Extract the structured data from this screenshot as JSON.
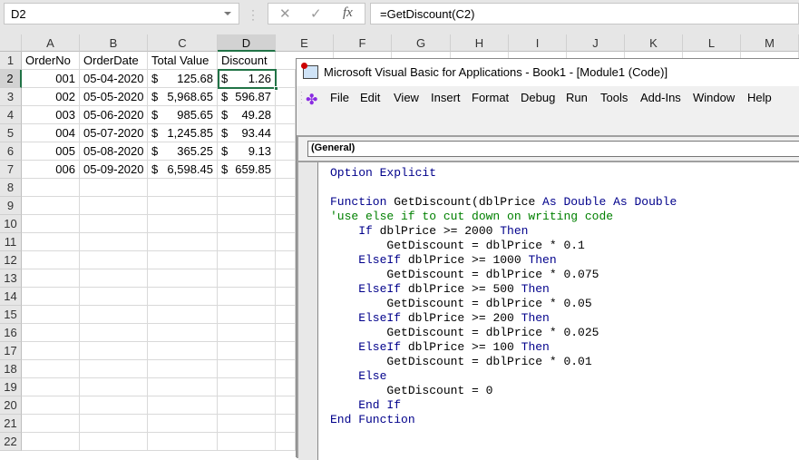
{
  "formula_bar": {
    "name_box": "D2",
    "cancel_icon": "✕",
    "enter_icon": "✓",
    "fx_label": "fx",
    "formula": "=GetDiscount(C2)"
  },
  "columns": [
    "A",
    "B",
    "C",
    "D",
    "E",
    "F",
    "G",
    "H",
    "I",
    "J",
    "K",
    "L",
    "M"
  ],
  "rows": [
    "1",
    "2",
    "3",
    "4",
    "5",
    "6",
    "7",
    "8",
    "9",
    "10",
    "11",
    "12",
    "13",
    "14",
    "15",
    "16",
    "17",
    "18",
    "19",
    "20",
    "21",
    "22"
  ],
  "headers": [
    "OrderNo",
    "OrderDate",
    "Total Value",
    "Discount"
  ],
  "data": [
    {
      "no": "001",
      "date": "05-04-2020",
      "total": "125.68",
      "discount": "1.26"
    },
    {
      "no": "002",
      "date": "05-05-2020",
      "total": "5,968.65",
      "discount": "596.87"
    },
    {
      "no": "003",
      "date": "05-06-2020",
      "total": "985.65",
      "discount": "49.28"
    },
    {
      "no": "004",
      "date": "05-07-2020",
      "total": "1,245.85",
      "discount": "93.44"
    },
    {
      "no": "005",
      "date": "05-08-2020",
      "total": "365.25",
      "discount": "9.13"
    },
    {
      "no": "006",
      "date": "05-09-2020",
      "total": "6,598.45",
      "discount": "659.85"
    }
  ],
  "currency": "$",
  "vba": {
    "title": "Microsoft Visual Basic for Applications - Book1 - [Module1 (Code)]",
    "menu": [
      "File",
      "Edit",
      "View",
      "Insert",
      "Format",
      "Debug",
      "Run",
      "Tools",
      "Add-Ins",
      "Window",
      "Help"
    ],
    "object_dropdown": "(General)",
    "code": [
      [
        [
          "kw",
          "Option Explicit"
        ]
      ],
      [],
      [
        [
          "kw",
          "Function "
        ],
        [
          "",
          "GetDiscount(dblPrice "
        ],
        [
          "kw",
          "As Double"
        ],
        [
          "",
          " "
        ],
        [
          "kw",
          "As Double"
        ]
      ],
      [
        [
          "cm",
          "'use else if to cut down on writing code"
        ]
      ],
      [
        [
          "kw",
          "    If "
        ],
        [
          "",
          "dblPrice >= 2000 "
        ],
        [
          "kw",
          "Then"
        ]
      ],
      [
        [
          "",
          "        GetDiscount = dblPrice * 0.1"
        ]
      ],
      [
        [
          "kw",
          "    ElseIf "
        ],
        [
          "",
          "dblPrice >= 1000 "
        ],
        [
          "kw",
          "Then"
        ]
      ],
      [
        [
          "",
          "        GetDiscount = dblPrice * 0.075"
        ]
      ],
      [
        [
          "kw",
          "    ElseIf "
        ],
        [
          "",
          "dblPrice >= 500 "
        ],
        [
          "kw",
          "Then"
        ]
      ],
      [
        [
          "",
          "        GetDiscount = dblPrice * 0.05"
        ]
      ],
      [
        [
          "kw",
          "    ElseIf "
        ],
        [
          "",
          "dblPrice >= 200 "
        ],
        [
          "kw",
          "Then"
        ]
      ],
      [
        [
          "",
          "        GetDiscount = dblPrice * 0.025"
        ]
      ],
      [
        [
          "kw",
          "    ElseIf "
        ],
        [
          "",
          "dblPrice >= 100 "
        ],
        [
          "kw",
          "Then"
        ]
      ],
      [
        [
          "",
          "        GetDiscount = dblPrice * 0.01"
        ]
      ],
      [
        [
          "kw",
          "    Else"
        ]
      ],
      [
        [
          "",
          "        GetDiscount = 0"
        ]
      ],
      [
        [
          "kw",
          "    End If"
        ]
      ],
      [
        [
          "kw",
          "End Function"
        ]
      ]
    ]
  }
}
